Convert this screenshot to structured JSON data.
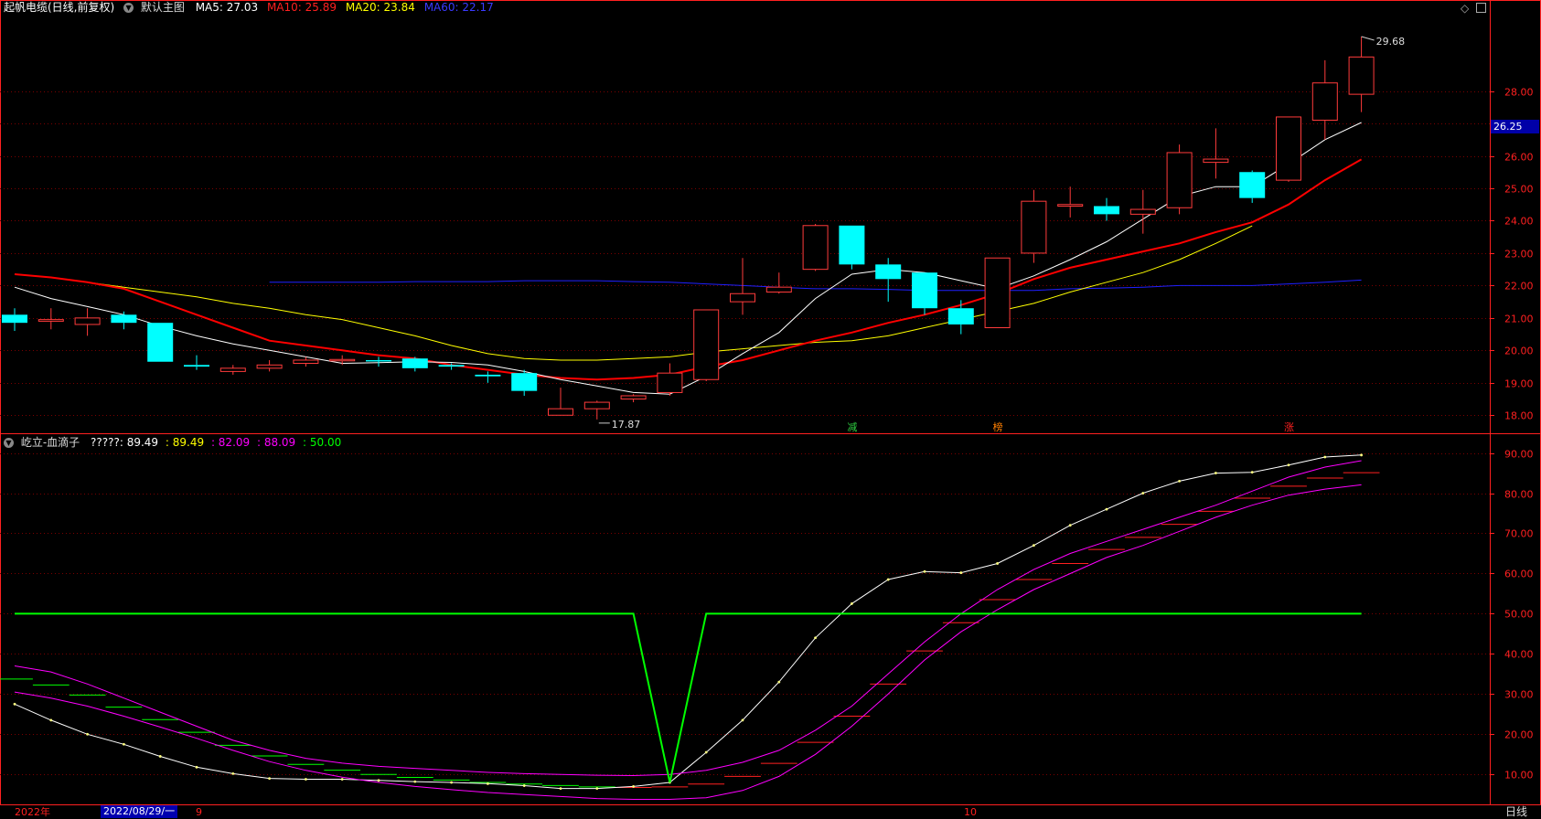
{
  "main_header": {
    "title": "起帆电缆(日线,前复权)",
    "panel": "默认主图",
    "ma5": "MA5: 27.03",
    "ma10": "MA10: 25.89",
    "ma20": "MA20: 23.84",
    "ma60": "MA60: 22.17"
  },
  "sub_header": {
    "title": "屹立-血滴子",
    "v1": "?????: 89.49",
    "v2": ": 89.49",
    "v3": ": 82.09",
    "v4": ": 88.09",
    "v5": ": 50.00"
  },
  "price_label": "26.25",
  "window_icons": [
    "diamond-icon",
    "window-icon"
  ],
  "footer": {
    "year": "2022年",
    "date": "2022/08/29/一",
    "m9": "9",
    "m10": "10",
    "period": "日线"
  },
  "colors": {
    "up": "#ff3b3b",
    "down": "#00ffff",
    "ma5": "#ffffff",
    "ma10": "#ff0000",
    "ma20": "#ffff00",
    "ma60": "#2020ff",
    "grid": "#7a0000",
    "axis": "#ff2020",
    "magenta": "#ff00ff",
    "green": "#00ff00"
  },
  "chart_data": [
    {
      "type": "candlestick",
      "y_ticks": [
        18,
        19,
        20,
        21,
        22,
        23,
        24,
        25,
        26,
        27,
        28
      ],
      "ylim": [
        17.5,
        30.3
      ],
      "annotations": {
        "high": "29.68",
        "low": "17.87"
      },
      "markers": [
        {
          "index": 23,
          "text": "减"
        },
        {
          "index": 27,
          "text": "榜"
        },
        {
          "index": 35,
          "text": "涨"
        }
      ],
      "candles": [
        {
          "o": 21.1,
          "c": 20.85,
          "h": 21.3,
          "l": 20.6
        },
        {
          "o": 20.9,
          "c": 20.95,
          "h": 21.3,
          "l": 20.65
        },
        {
          "o": 20.8,
          "c": 21.0,
          "h": 21.3,
          "l": 20.45
        },
        {
          "o": 21.1,
          "c": 20.85,
          "h": 21.2,
          "l": 20.65
        },
        {
          "o": 20.85,
          "c": 19.65,
          "h": 20.85,
          "l": 19.65
        },
        {
          "o": 19.55,
          "c": 19.5,
          "h": 19.85,
          "l": 19.4
        },
        {
          "o": 19.35,
          "c": 19.45,
          "h": 19.55,
          "l": 19.25
        },
        {
          "o": 19.45,
          "c": 19.55,
          "h": 19.7,
          "l": 19.35
        },
        {
          "o": 19.6,
          "c": 19.7,
          "h": 19.8,
          "l": 19.5
        },
        {
          "o": 19.7,
          "c": 19.72,
          "h": 19.85,
          "l": 19.55
        },
        {
          "o": 19.7,
          "c": 19.68,
          "h": 19.8,
          "l": 19.5
        },
        {
          "o": 19.75,
          "c": 19.45,
          "h": 19.8,
          "l": 19.35
        },
        {
          "o": 19.55,
          "c": 19.5,
          "h": 19.6,
          "l": 19.4
        },
        {
          "o": 19.25,
          "c": 19.2,
          "h": 19.35,
          "l": 19.0
        },
        {
          "o": 19.3,
          "c": 18.75,
          "h": 19.4,
          "l": 18.6
        },
        {
          "o": 18.0,
          "c": 18.2,
          "h": 18.85,
          "l": 18.0
        },
        {
          "o": 18.2,
          "c": 18.4,
          "h": 18.45,
          "l": 17.87
        },
        {
          "o": 18.5,
          "c": 18.6,
          "h": 18.65,
          "l": 18.4
        },
        {
          "o": 18.7,
          "c": 19.3,
          "h": 19.6,
          "l": 18.6
        },
        {
          "o": 19.1,
          "c": 21.25,
          "h": 21.25,
          "l": 19.05
        },
        {
          "o": 21.5,
          "c": 21.75,
          "h": 22.85,
          "l": 21.1
        },
        {
          "o": 21.8,
          "c": 21.95,
          "h": 22.4,
          "l": 21.75
        },
        {
          "o": 22.5,
          "c": 23.85,
          "h": 23.9,
          "l": 22.45
        },
        {
          "o": 23.85,
          "c": 22.65,
          "h": 23.85,
          "l": 22.5
        },
        {
          "o": 22.65,
          "c": 22.2,
          "h": 22.85,
          "l": 21.5
        },
        {
          "o": 22.4,
          "c": 21.3,
          "h": 22.4,
          "l": 21.1
        },
        {
          "o": 21.3,
          "c": 20.8,
          "h": 21.55,
          "l": 20.5
        },
        {
          "o": 20.7,
          "c": 22.85,
          "h": 22.85,
          "l": 20.7
        },
        {
          "o": 23.0,
          "c": 24.6,
          "h": 24.95,
          "l": 22.7
        },
        {
          "o": 24.45,
          "c": 24.5,
          "h": 25.05,
          "l": 24.1
        },
        {
          "o": 24.45,
          "c": 24.2,
          "h": 24.7,
          "l": 24.0
        },
        {
          "o": 24.2,
          "c": 24.35,
          "h": 24.95,
          "l": 23.6
        },
        {
          "o": 24.4,
          "c": 26.1,
          "h": 26.35,
          "l": 24.2
        },
        {
          "o": 25.8,
          "c": 25.9,
          "h": 26.85,
          "l": 25.3
        },
        {
          "o": 25.5,
          "c": 24.7,
          "h": 25.55,
          "l": 24.55
        },
        {
          "o": 25.25,
          "c": 27.2,
          "h": 27.2,
          "l": 25.2
        },
        {
          "o": 27.1,
          "c": 28.25,
          "h": 28.95,
          "l": 26.5
        },
        {
          "o": 27.9,
          "c": 29.05,
          "h": 29.68,
          "l": 27.35
        }
      ],
      "ma5": [
        21.95,
        21.6,
        21.35,
        21.1,
        20.75,
        20.45,
        20.2,
        20.0,
        19.8,
        19.6,
        19.62,
        19.65,
        19.63,
        19.55,
        19.35,
        19.1,
        18.9,
        18.7,
        18.65,
        19.2,
        19.9,
        20.55,
        21.6,
        22.35,
        22.5,
        22.4,
        22.15,
        21.9,
        22.3,
        22.8,
        23.35,
        24.05,
        24.75,
        25.05,
        25.05,
        25.75,
        26.5,
        27.03
      ],
      "ma10": [
        22.35,
        22.25,
        22.1,
        21.9,
        21.5,
        21.1,
        20.7,
        20.3,
        20.15,
        20.0,
        19.85,
        19.75,
        19.55,
        19.4,
        19.25,
        19.15,
        19.1,
        19.15,
        19.25,
        19.5,
        19.7,
        20.0,
        20.3,
        20.55,
        20.85,
        21.1,
        21.4,
        21.75,
        22.2,
        22.55,
        22.8,
        23.05,
        23.3,
        23.65,
        23.95,
        24.5,
        25.25,
        25.89
      ],
      "ma20": [
        22.35,
        22.25,
        22.1,
        21.95,
        21.8,
        21.65,
        21.45,
        21.3,
        21.1,
        20.95,
        20.7,
        20.45,
        20.15,
        19.9,
        19.75,
        19.7,
        19.7,
        19.75,
        19.8,
        19.95,
        20.05,
        20.15,
        20.25,
        20.3,
        20.45,
        20.7,
        20.95,
        21.2,
        21.45,
        21.8,
        22.1,
        22.4,
        22.8,
        23.3,
        23.84
      ],
      "ma20_start": 0,
      "ma60": [
        22.1,
        22.1,
        22.1,
        22.1,
        22.12,
        22.12,
        22.12,
        22.15,
        22.15,
        22.15,
        22.12,
        22.1,
        22.05,
        22.0,
        21.95,
        21.9,
        21.9,
        21.88,
        21.85,
        21.85,
        21.85,
        21.85,
        21.9,
        21.92,
        21.95,
        22.0,
        22.0,
        22.0,
        22.05,
        22.1,
        22.17
      ]
    },
    {
      "type": "line",
      "title": "屹立-血滴子",
      "y_ticks": [
        10,
        20,
        30,
        40,
        50,
        60,
        70,
        80,
        90
      ],
      "ylim": [
        3,
        94
      ],
      "series": [
        {
          "name": "?????",
          "color": "#ffffff",
          "values": [
            27.5,
            23.5,
            20,
            17.5,
            14.5,
            11.8,
            10.2,
            9,
            8.8,
            8.8,
            8.5,
            8.2,
            8,
            7.7,
            7.2,
            6.5,
            6.5,
            7,
            8,
            15.5,
            23.5,
            33,
            44,
            52.5,
            58.5,
            60.5,
            60.2,
            62.5,
            67,
            72,
            76,
            80,
            83,
            85,
            85.2,
            87,
            89,
            89.49
          ]
        },
        {
          "name": "magenta_upper",
          "color": "#ff00ff",
          "values": [
            37,
            35.5,
            32.5,
            29,
            25.5,
            22,
            18.5,
            16,
            14,
            12.8,
            12,
            11.5,
            11,
            10.5,
            10.2,
            10,
            9.8,
            9.7,
            10,
            11,
            13,
            16,
            21,
            27,
            35,
            43,
            50,
            56,
            61,
            65,
            68,
            71,
            74,
            77,
            80.5,
            84,
            86.5,
            88.09
          ]
        },
        {
          "name": "magenta_lower",
          "color": "#ff00ff",
          "values": [
            30.5,
            29,
            27,
            24.5,
            21.8,
            19,
            16,
            13.2,
            11,
            9.3,
            8,
            7,
            6.2,
            5.5,
            5,
            4.5,
            4,
            3.8,
            3.8,
            4.2,
            6,
            9.5,
            15,
            22,
            30,
            38.5,
            45.5,
            51,
            56,
            60,
            64,
            67,
            70.5,
            74,
            77,
            79.5,
            81,
            82.09
          ]
        },
        {
          "name": "green",
          "color": "#00ff00",
          "values": [
            50,
            50,
            50,
            50,
            50,
            50,
            50,
            50,
            50,
            50,
            50,
            50,
            50,
            50,
            50,
            50,
            50,
            50,
            8,
            50,
            50,
            50,
            50,
            50,
            50,
            50,
            50,
            50,
            50,
            50,
            50,
            50,
            50,
            50,
            50,
            50,
            50,
            50
          ]
        }
      ]
    }
  ]
}
